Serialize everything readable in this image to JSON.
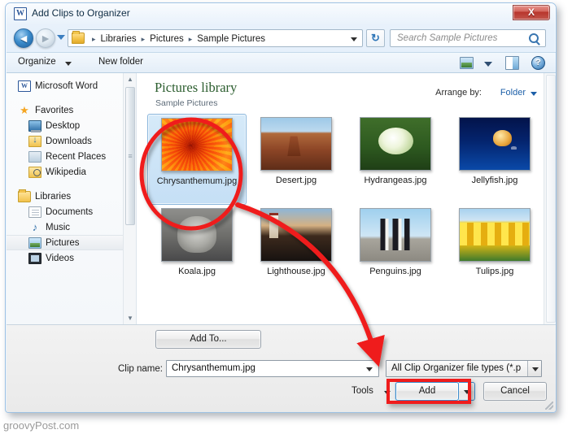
{
  "window": {
    "title": "Add Clips to Organizer",
    "app_icon": "word-icon",
    "close_label": "X"
  },
  "address_bar": {
    "back_glyph": "◄",
    "forward_glyph": "►",
    "crumbs": [
      "Libraries",
      "Pictures",
      "Sample Pictures"
    ],
    "separator": "▸",
    "refresh_glyph": "↻",
    "search_placeholder": "Search Sample Pictures"
  },
  "toolbar": {
    "organize_label": "Organize",
    "new_folder_label": "New folder",
    "view_icon": "change-view-icon",
    "pane_icon": "preview-pane-icon",
    "help_icon": "help-icon",
    "help_glyph": "?"
  },
  "nav_pane": {
    "items": [
      {
        "label": "Microsoft Word",
        "icon": "word-icon",
        "type": "app",
        "indent": 0,
        "selected": false,
        "glyph": "W"
      },
      {
        "label": "Favorites",
        "icon": "star-icon",
        "type": "group",
        "indent": 0,
        "selected": false,
        "glyph": "★"
      },
      {
        "label": "Desktop",
        "icon": "desktop-icon",
        "type": "item",
        "indent": 1,
        "selected": false,
        "glyph": ""
      },
      {
        "label": "Downloads",
        "icon": "downloads-icon",
        "type": "item",
        "indent": 1,
        "selected": false,
        "glyph": ""
      },
      {
        "label": "Recent Places",
        "icon": "recent-places-icon",
        "type": "item",
        "indent": 1,
        "selected": false,
        "glyph": ""
      },
      {
        "label": "Wikipedia",
        "icon": "wikipedia-icon",
        "type": "item",
        "indent": 1,
        "selected": false,
        "glyph": ""
      },
      {
        "label": "Libraries",
        "icon": "libraries-icon",
        "type": "group",
        "indent": 0,
        "selected": false,
        "glyph": ""
      },
      {
        "label": "Documents",
        "icon": "documents-icon",
        "type": "item",
        "indent": 1,
        "selected": false,
        "glyph": ""
      },
      {
        "label": "Music",
        "icon": "music-icon",
        "type": "item",
        "indent": 1,
        "selected": false,
        "glyph": "♪"
      },
      {
        "label": "Pictures",
        "icon": "pictures-icon",
        "type": "item",
        "indent": 1,
        "selected": true,
        "glyph": ""
      },
      {
        "label": "Videos",
        "icon": "videos-icon",
        "type": "item",
        "indent": 1,
        "selected": false,
        "glyph": ""
      }
    ],
    "scroll_up_glyph": "▲",
    "scroll_down_glyph": "▼"
  },
  "file_pane": {
    "library_title": "Pictures library",
    "library_subtitle": "Sample Pictures",
    "arrange_label": "Arrange by:",
    "arrange_value": "Folder",
    "files": [
      {
        "name": "Chrysanthemum.jpg",
        "art": "t-chrys",
        "selected": true
      },
      {
        "name": "Desert.jpg",
        "art": "t-desert",
        "selected": false
      },
      {
        "name": "Hydrangeas.jpg",
        "art": "t-hydran",
        "selected": false
      },
      {
        "name": "Jellyfish.jpg",
        "art": "t-jelly",
        "selected": false
      },
      {
        "name": "Koala.jpg",
        "art": "t-koala",
        "selected": false
      },
      {
        "name": "Lighthouse.jpg",
        "art": "t-light",
        "selected": false
      },
      {
        "name": "Penguins.jpg",
        "art": "t-peng",
        "selected": false
      },
      {
        "name": "Tulips.jpg",
        "art": "t-tulip",
        "selected": false
      }
    ]
  },
  "bottom_panel": {
    "add_to_label": "Add To...",
    "clip_name_label": "Clip name:",
    "clip_name_value": "Chrysanthemum.jpg",
    "file_type_value": "All Clip Organizer file types  (*.p",
    "tools_label": "Tools",
    "add_label": "Add",
    "cancel_label": "Cancel"
  },
  "annotations": {
    "highlight_color": "#ef1c1c",
    "callouts": [
      "selected-file-circle",
      "add-button-box",
      "curved-arrow"
    ]
  },
  "watermark": {
    "text": "groovyPost.com"
  }
}
